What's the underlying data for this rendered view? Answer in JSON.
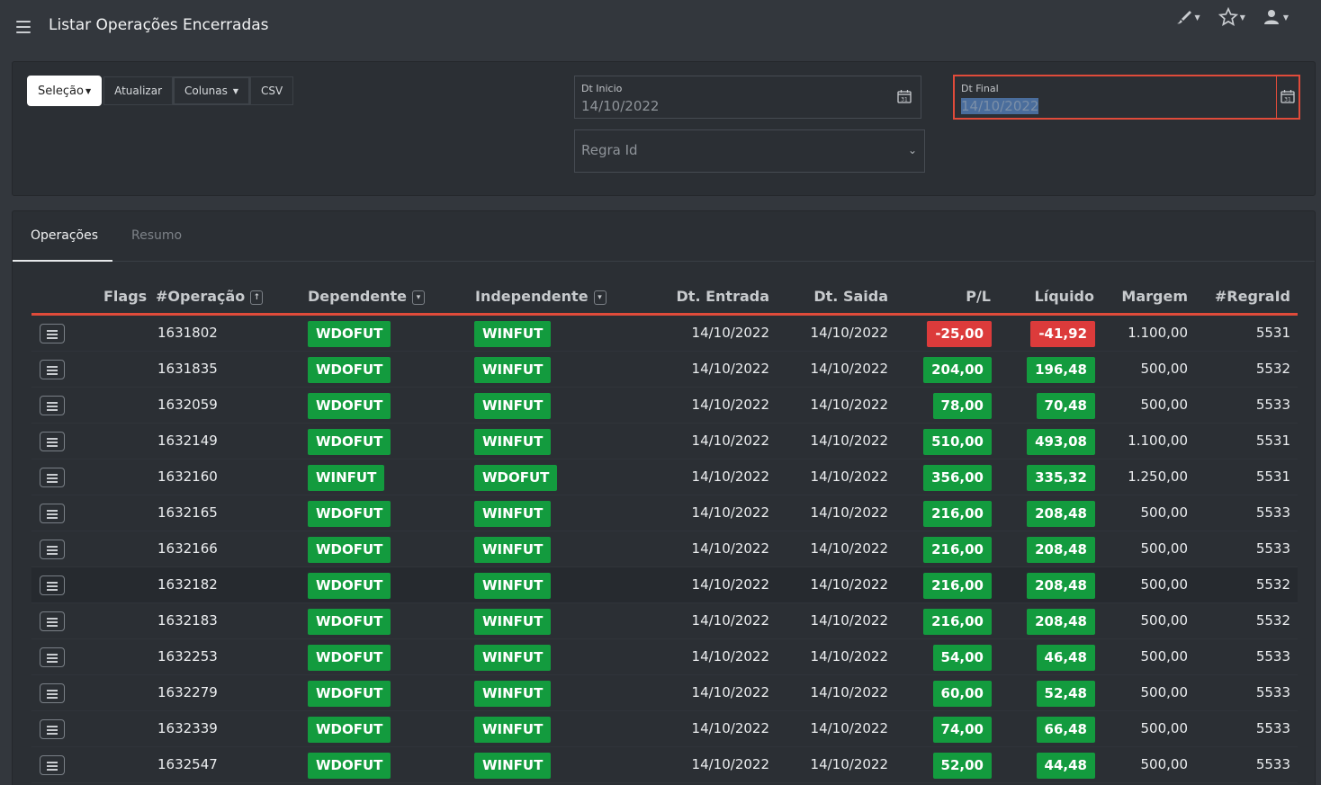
{
  "header": {
    "title": "Listar Operações Encerradas",
    "icons": [
      "brush-icon",
      "star-icon",
      "user-icon"
    ]
  },
  "toolbar": {
    "selecao_label": "Seleção",
    "atualizar_label": "Atualizar",
    "colunas_label": "Colunas",
    "csv_label": "CSV"
  },
  "filters": {
    "dt_inicio": {
      "label": "Dt Inicio",
      "value": "14/10/2022"
    },
    "dt_final": {
      "label": "Dt Final",
      "value": "14/10/2022"
    },
    "regra_id": {
      "placeholder": "Regra Id"
    }
  },
  "tabs": [
    {
      "label": "Operações",
      "active": true
    },
    {
      "label": "Resumo",
      "active": false
    }
  ],
  "table": {
    "columns": [
      "Flags",
      "#Operação",
      "Dependente",
      "Independente",
      "Dt. Entrada",
      "Dt. Saida",
      "P/L",
      "Líquido",
      "Margem",
      "#RegraId"
    ],
    "rows": [
      {
        "op": "1631802",
        "dep": "WDOFUT",
        "ind": "WINFUT",
        "entrada": "14/10/2022",
        "saida": "14/10/2022",
        "pl": "-25,00",
        "liq": "-41,92",
        "margem": "1.100,00",
        "regra": "5531",
        "negative": true
      },
      {
        "op": "1631835",
        "dep": "WDOFUT",
        "ind": "WINFUT",
        "entrada": "14/10/2022",
        "saida": "14/10/2022",
        "pl": "204,00",
        "liq": "196,48",
        "margem": "500,00",
        "regra": "5532",
        "negative": false
      },
      {
        "op": "1632059",
        "dep": "WDOFUT",
        "ind": "WINFUT",
        "entrada": "14/10/2022",
        "saida": "14/10/2022",
        "pl": "78,00",
        "liq": "70,48",
        "margem": "500,00",
        "regra": "5533",
        "negative": false
      },
      {
        "op": "1632149",
        "dep": "WDOFUT",
        "ind": "WINFUT",
        "entrada": "14/10/2022",
        "saida": "14/10/2022",
        "pl": "510,00",
        "liq": "493,08",
        "margem": "1.100,00",
        "regra": "5531",
        "negative": false
      },
      {
        "op": "1632160",
        "dep": "WINFUT",
        "ind": "WDOFUT",
        "entrada": "14/10/2022",
        "saida": "14/10/2022",
        "pl": "356,00",
        "liq": "335,32",
        "margem": "1.250,00",
        "regra": "5531",
        "negative": false
      },
      {
        "op": "1632165",
        "dep": "WDOFUT",
        "ind": "WINFUT",
        "entrada": "14/10/2022",
        "saida": "14/10/2022",
        "pl": "216,00",
        "liq": "208,48",
        "margem": "500,00",
        "regra": "5533",
        "negative": false
      },
      {
        "op": "1632166",
        "dep": "WDOFUT",
        "ind": "WINFUT",
        "entrada": "14/10/2022",
        "saida": "14/10/2022",
        "pl": "216,00",
        "liq": "208,48",
        "margem": "500,00",
        "regra": "5533",
        "negative": false
      },
      {
        "op": "1632182",
        "dep": "WDOFUT",
        "ind": "WINFUT",
        "entrada": "14/10/2022",
        "saida": "14/10/2022",
        "pl": "216,00",
        "liq": "208,48",
        "margem": "500,00",
        "regra": "5532",
        "negative": false,
        "highlight": true
      },
      {
        "op": "1632183",
        "dep": "WDOFUT",
        "ind": "WINFUT",
        "entrada": "14/10/2022",
        "saida": "14/10/2022",
        "pl": "216,00",
        "liq": "208,48",
        "margem": "500,00",
        "regra": "5532",
        "negative": false
      },
      {
        "op": "1632253",
        "dep": "WDOFUT",
        "ind": "WINFUT",
        "entrada": "14/10/2022",
        "saida": "14/10/2022",
        "pl": "54,00",
        "liq": "46,48",
        "margem": "500,00",
        "regra": "5533",
        "negative": false
      },
      {
        "op": "1632279",
        "dep": "WDOFUT",
        "ind": "WINFUT",
        "entrada": "14/10/2022",
        "saida": "14/10/2022",
        "pl": "60,00",
        "liq": "52,48",
        "margem": "500,00",
        "regra": "5533",
        "negative": false
      },
      {
        "op": "1632339",
        "dep": "WDOFUT",
        "ind": "WINFUT",
        "entrada": "14/10/2022",
        "saida": "14/10/2022",
        "pl": "74,00",
        "liq": "66,48",
        "margem": "500,00",
        "regra": "5533",
        "negative": false
      },
      {
        "op": "1632547",
        "dep": "WDOFUT",
        "ind": "WINFUT",
        "entrada": "14/10/2022",
        "saida": "14/10/2022",
        "pl": "52,00",
        "liq": "44,48",
        "margem": "500,00",
        "regra": "5533",
        "negative": false
      }
    ]
  },
  "colors": {
    "positive": "#139b3e",
    "negative": "#dc3b3b",
    "accent": "#e04b3a",
    "background": "#33373d"
  }
}
